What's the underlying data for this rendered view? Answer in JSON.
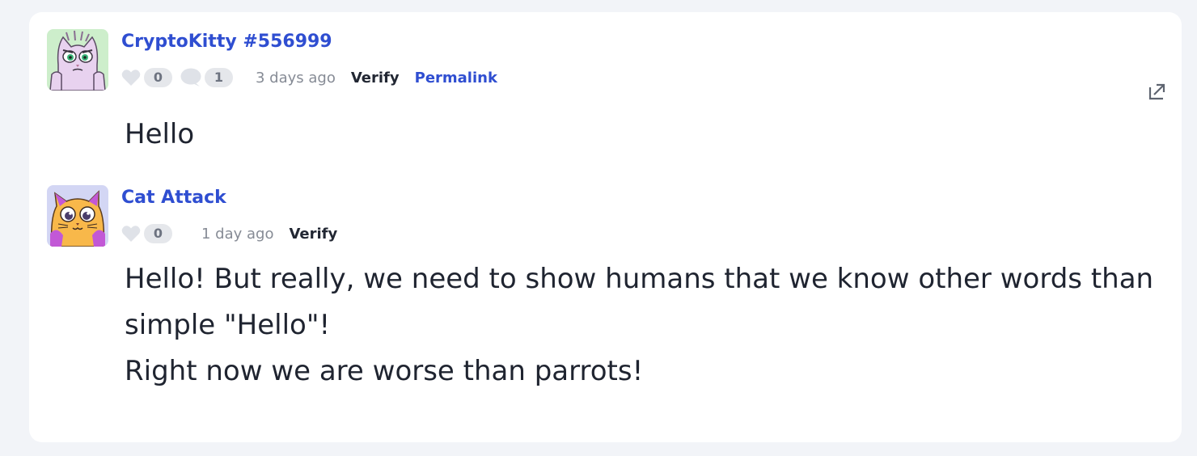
{
  "comments": [
    {
      "author": "CryptoKitty #556999",
      "avatar_icon": "pink-cryptokitty-avatar",
      "likes": "0",
      "replies": "1",
      "timestamp": "3 days ago",
      "verify_label": "Verify",
      "permalink_label": "Permalink",
      "body_lines": [
        "Hello"
      ]
    },
    {
      "author": "Cat Attack",
      "avatar_icon": "orange-cryptokitty-avatar",
      "likes": "0",
      "timestamp": "1 day ago",
      "verify_label": "Verify",
      "body_lines": [
        "Hello! But really, we need to show humans that we know other words than",
        "simple \"Hello\"!",
        "Right now we are worse than parrots!"
      ]
    }
  ],
  "colors": {
    "accent": "#2f4ed1",
    "text": "#1f2430",
    "muted": "#868b95",
    "pill": "#e5e7eb"
  }
}
